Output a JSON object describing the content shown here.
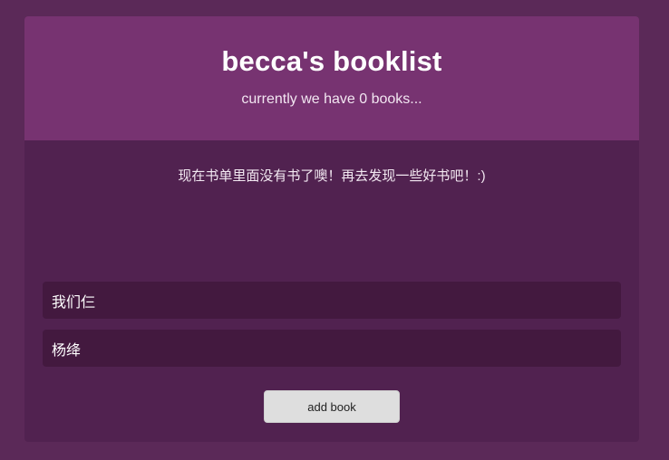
{
  "header": {
    "title": "becca's booklist",
    "subtitle": "currently we have 0 books..."
  },
  "book_list": {
    "empty_message": "现在书单里面没有书了噢！再去发现一些好书吧！:)"
  },
  "form": {
    "title_input": {
      "value": "我们仨"
    },
    "author_input": {
      "value": "杨绛"
    },
    "submit_label": "add book"
  },
  "colors": {
    "page_background": "#5b2958",
    "header_background": "#773371",
    "panel_background": "#512250",
    "input_background": "#43193f",
    "button_background": "#dedede"
  }
}
